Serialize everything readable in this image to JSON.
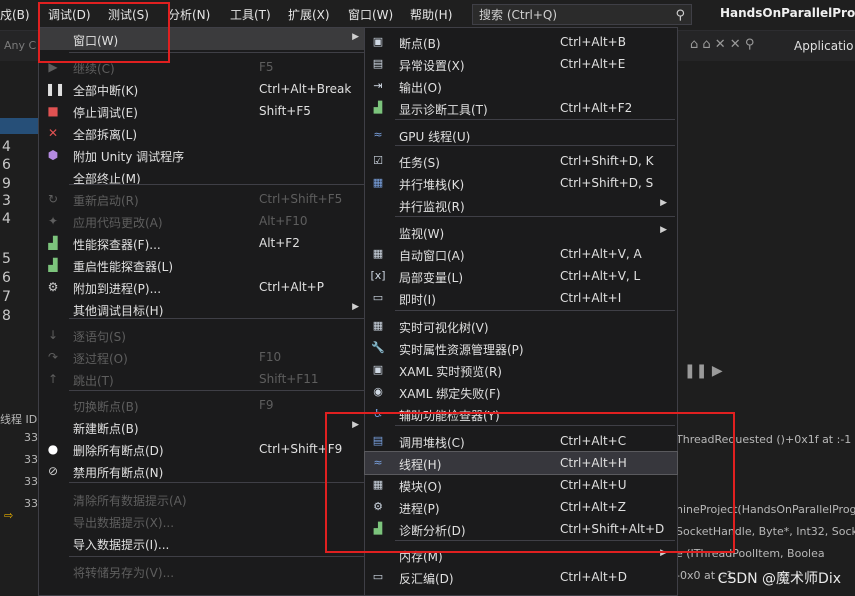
{
  "menubar": {
    "items": [
      "戍(B)",
      "调试(D)",
      "测试(S)",
      "分析(N)",
      "工具(T)",
      "扩展(X)",
      "窗口(W)",
      "帮助(H)"
    ],
    "search_placeholder": "搜索 (Ctrl+Q)",
    "app_title": "HandsOnParallelProg"
  },
  "background": {
    "toolbar_text": "Any C",
    "toolbar_right": "Applicatio",
    "gutter_numbers": [
      "4",
      "6",
      "9",
      "3",
      "4",
      "5",
      "6",
      "7",
      "8"
    ],
    "pane_label": "线程 ID:",
    "row_ids": [
      "33",
      "33",
      "33",
      "33",
      "33",
      "33",
      "95",
      "33",
      "33",
      "33",
      "33",
      "33"
    ],
    "right_lines": [
      "ThreadRequested ()+0x1f at :-1",
      "nineProject(HandsOnParallelProg",
      "SocketHandle, Byte*, Int32, Socke",
      "e (IThreadPoolItem, Boolea",
      "-0x0 at :-1"
    ],
    "watermark": "CSDN @魔术师Dix"
  },
  "debug_menu": {
    "items": [
      {
        "label": "窗口(W)",
        "shortcut": "",
        "icon": "blank",
        "disabled": false,
        "submenu": true,
        "highlight": true
      },
      {
        "label": "继续(C)",
        "shortcut": "F5",
        "icon": "play-icon",
        "disabled": true,
        "submenu": false
      },
      {
        "label": "全部中断(K)",
        "shortcut": "Ctrl+Alt+Break",
        "icon": "pause-icon",
        "disabled": false,
        "submenu": false
      },
      {
        "label": "停止调试(E)",
        "shortcut": "Shift+F5",
        "icon": "stop-icon",
        "disabled": false,
        "submenu": false
      },
      {
        "label": "全部拆离(L)",
        "shortcut": "",
        "icon": "detach-icon",
        "disabled": false,
        "submenu": false
      },
      {
        "label": "附加 Unity 调试程序",
        "shortcut": "",
        "icon": "unity-icon",
        "disabled": false,
        "submenu": false
      },
      {
        "label": "全部终止(M)",
        "shortcut": "",
        "icon": "blank",
        "disabled": false,
        "submenu": false
      },
      {
        "label": "重新启动(R)",
        "shortcut": "Ctrl+Shift+F5",
        "icon": "restart-icon",
        "disabled": true,
        "submenu": false
      },
      {
        "label": "应用代码更改(A)",
        "shortcut": "Alt+F10",
        "icon": "hot-reload-icon",
        "disabled": true,
        "submenu": false
      },
      {
        "label": "性能探查器(F)...",
        "shortcut": "Alt+F2",
        "icon": "profiler-icon",
        "disabled": false,
        "submenu": false
      },
      {
        "label": "重启性能探查器(L)",
        "shortcut": "",
        "icon": "profiler-restart-icon",
        "disabled": false,
        "submenu": false
      },
      {
        "label": "附加到进程(P)...",
        "shortcut": "Ctrl+Alt+P",
        "icon": "attach-icon",
        "disabled": false,
        "submenu": false
      },
      {
        "label": "其他调试目标(H)",
        "shortcut": "",
        "icon": "blank",
        "disabled": false,
        "submenu": true
      },
      {
        "label": "逐语句(S)",
        "shortcut": "",
        "icon": "step-into-icon",
        "disabled": true,
        "submenu": false
      },
      {
        "label": "逐过程(O)",
        "shortcut": "F10",
        "icon": "step-over-icon",
        "disabled": true,
        "submenu": false
      },
      {
        "label": "跳出(T)",
        "shortcut": "Shift+F11",
        "icon": "step-out-icon",
        "disabled": true,
        "submenu": false
      },
      {
        "label": "切换断点(B)",
        "shortcut": "F9",
        "icon": "blank",
        "disabled": true,
        "submenu": false
      },
      {
        "label": "新建断点(B)",
        "shortcut": "",
        "icon": "blank",
        "disabled": false,
        "submenu": true
      },
      {
        "label": "删除所有断点(D)",
        "shortcut": "Ctrl+Shift+F9",
        "icon": "delete-breakpoints-icon",
        "disabled": false,
        "submenu": false
      },
      {
        "label": "禁用所有断点(N)",
        "shortcut": "",
        "icon": "disable-breakpoints-icon",
        "disabled": false,
        "submenu": false
      },
      {
        "label": "清除所有数据提示(A)",
        "shortcut": "",
        "icon": "blank",
        "disabled": true,
        "submenu": false
      },
      {
        "label": "导出数据提示(X)...",
        "shortcut": "",
        "icon": "blank",
        "disabled": true,
        "submenu": false
      },
      {
        "label": "导入数据提示(I)...",
        "shortcut": "",
        "icon": "blank",
        "disabled": false,
        "submenu": false
      },
      {
        "label": "将转储另存为(V)...",
        "shortcut": "",
        "icon": "blank",
        "disabled": true,
        "submenu": false
      }
    ]
  },
  "window_menu": {
    "items": [
      {
        "label": "断点(B)",
        "shortcut": "Ctrl+Alt+B",
        "icon": "breakpoints-window-icon",
        "submenu": false
      },
      {
        "label": "异常设置(X)",
        "shortcut": "Ctrl+Alt+E",
        "icon": "exception-settings-icon",
        "submenu": false
      },
      {
        "label": "输出(O)",
        "shortcut": "",
        "icon": "output-icon",
        "submenu": false
      },
      {
        "label": "显示诊断工具(T)",
        "shortcut": "Ctrl+Alt+F2",
        "icon": "diagnostic-tools-icon",
        "submenu": false
      },
      {
        "label": "GPU 线程(U)",
        "shortcut": "",
        "icon": "gpu-threads-icon",
        "submenu": false
      },
      {
        "label": "任务(S)",
        "shortcut": "Ctrl+Shift+D, K",
        "icon": "tasks-icon",
        "submenu": false
      },
      {
        "label": "并行堆栈(K)",
        "shortcut": "Ctrl+Shift+D, S",
        "icon": "parallel-stacks-icon",
        "submenu": false
      },
      {
        "label": "并行监视(R)",
        "shortcut": "",
        "icon": "blank",
        "submenu": true
      },
      {
        "label": "监视(W)",
        "shortcut": "",
        "icon": "blank",
        "submenu": true
      },
      {
        "label": "自动窗口(A)",
        "shortcut": "Ctrl+Alt+V, A",
        "icon": "autos-icon",
        "submenu": false
      },
      {
        "label": "局部变量(L)",
        "shortcut": "Ctrl+Alt+V, L",
        "icon": "locals-icon",
        "submenu": false
      },
      {
        "label": "即时(I)",
        "shortcut": "Ctrl+Alt+I",
        "icon": "immediate-icon",
        "submenu": false
      },
      {
        "label": "实时可视化树(V)",
        "shortcut": "",
        "icon": "visual-tree-icon",
        "submenu": false
      },
      {
        "label": "实时属性资源管理器(P)",
        "shortcut": "",
        "icon": "property-explorer-icon",
        "submenu": false
      },
      {
        "label": "XAML 实时预览(R)",
        "shortcut": "",
        "icon": "xaml-preview-icon",
        "submenu": false
      },
      {
        "label": "XAML 绑定失败(F)",
        "shortcut": "",
        "icon": "xaml-binding-icon",
        "submenu": false
      },
      {
        "label": "辅助功能检查器(Y)",
        "shortcut": "",
        "icon": "accessibility-icon",
        "submenu": false
      },
      {
        "label": "调用堆栈(C)",
        "shortcut": "Ctrl+Alt+C",
        "icon": "call-stack-icon",
        "submenu": false
      },
      {
        "label": "线程(H)",
        "shortcut": "Ctrl+Alt+H",
        "icon": "threads-icon",
        "submenu": false
      },
      {
        "label": "模块(O)",
        "shortcut": "Ctrl+Alt+U",
        "icon": "modules-icon",
        "submenu": false
      },
      {
        "label": "进程(P)",
        "shortcut": "Ctrl+Alt+Z",
        "icon": "processes-icon",
        "submenu": false
      },
      {
        "label": "诊断分析(D)",
        "shortcut": "Ctrl+Shift+Alt+D",
        "icon": "diagnostic-analysis-icon",
        "submenu": false
      },
      {
        "label": "内存(M)",
        "shortcut": "",
        "icon": "blank",
        "submenu": true
      },
      {
        "label": "反汇编(D)",
        "shortcut": "Ctrl+Alt+D",
        "icon": "disassembly-icon",
        "submenu": false
      }
    ]
  },
  "colors": {
    "accent_red": "#e02020",
    "menu_bg": "#1b1b1c",
    "disabled_text": "#5e5e5e"
  }
}
